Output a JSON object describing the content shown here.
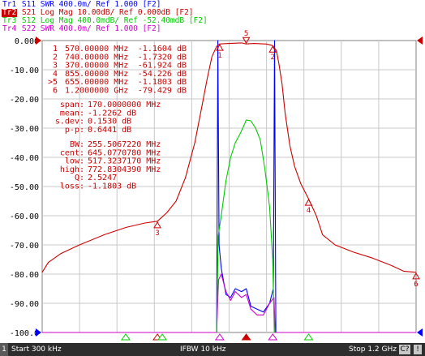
{
  "colors": {
    "tr1": "#0000ff",
    "tr2": "#cc0000",
    "tr3": "#00cc00",
    "tr4": "#cc00cc",
    "grid": "#c8c8c8",
    "bg": "#ffffff"
  },
  "traces": [
    {
      "tag": "Tr1",
      "text": "S11  SWR 400.0m/ Ref 1.000 [F2]",
      "color": "#0000ff",
      "active": false
    },
    {
      "tag": "Tr2",
      "text": "S21  Log Mag 10.00dB/ Ref 0.000dB [F2]",
      "color": "#cc0000",
      "active": true
    },
    {
      "tag": "Tr3",
      "text": "S12  Log Mag 400.0mdB/ Ref -52.40mdB [F2]",
      "color": "#00cc00",
      "active": false
    },
    {
      "tag": "Tr4",
      "text": "S22  SWR 400.0m/ Ref 1.000 [F2]",
      "color": "#cc00cc",
      "active": false
    }
  ],
  "y_axis_labels": [
    "0.000",
    "-10.00",
    "-20.00",
    "-30.00",
    "-40.00",
    "-50.00",
    "-60.00",
    "-70.00",
    "-80.00",
    "-90.00",
    "-100.0"
  ],
  "markers": [
    {
      "id": "1",
      "freq": "570.00000 MHz",
      "value": "-1.1604 dB",
      "active": false
    },
    {
      "id": "2",
      "freq": "740.00000 MHz",
      "value": "-1.7320 dB",
      "active": false
    },
    {
      "id": "3",
      "freq": "370.00000 MHz",
      "value": "-61.924 dB",
      "active": false
    },
    {
      "id": "4",
      "freq": "855.00000 MHz",
      "value": "-54.226 dB",
      "active": false
    },
    {
      "id": "5",
      "freq": "655.00000 MHz",
      "value": "-1.1803 dB",
      "active": true
    },
    {
      "id": "6",
      "freq": "1.2000000 GHz",
      "value": "-79.429 dB",
      "active": false
    }
  ],
  "stats": [
    {
      "label": "span:",
      "value": "170.0000000 MHz"
    },
    {
      "label": "mean:",
      "value": "-1.2262 dB"
    },
    {
      "label": "s.dev:",
      "value": "0.1530 dB"
    },
    {
      "label": "p-p:",
      "value": "0.6441 dB"
    }
  ],
  "filter": [
    {
      "label": "BW:",
      "value": "255.5067220 MHz"
    },
    {
      "label": "cent:",
      "value": "645.0770780 MHz"
    },
    {
      "label": "low:",
      "value": "517.3237170 MHz"
    },
    {
      "label": "high:",
      "value": "772.8304390 MHz"
    },
    {
      "label": "Q:",
      "value": "2.5247"
    },
    {
      "label": "loss:",
      "value": "-1.1803 dB"
    }
  ],
  "status": {
    "channel": "1",
    "start": "Start 300 kHz",
    "ifbw": "IFBW 10 kHz",
    "stop": "Stop 1.2 GHz",
    "c_badge": "C?",
    "check": "!"
  },
  "chart_data": {
    "type": "line",
    "title": "",
    "xlabel": "",
    "ylabel": "",
    "xlim_mhz": [
      0.3,
      1200
    ],
    "ylim": [
      -100,
      0
    ],
    "grid": true,
    "series": [
      {
        "name": "S21 Log Mag",
        "color": "#cc0000",
        "x": [
          0.3,
          20,
          60,
          120,
          200,
          270,
          330,
          370,
          400,
          430,
          460,
          490,
          510,
          530,
          545,
          560,
          570,
          600,
          640,
          655,
          680,
          720,
          740,
          752,
          760,
          770,
          780,
          795,
          810,
          830,
          855,
          880,
          900,
          940,
          1000,
          1060,
          1120,
          1160,
          1200
        ],
        "values": [
          -79.4,
          -76.0,
          -73.0,
          -70.0,
          -66.5,
          -64.0,
          -62.5,
          -61.9,
          -59.0,
          -55.0,
          -47.0,
          -35.0,
          -24.0,
          -13.0,
          -5.5,
          -2.0,
          -1.16,
          -1.0,
          -0.8,
          -1.18,
          -1.0,
          -1.2,
          -1.73,
          -3.5,
          -8.0,
          -15.0,
          -25.0,
          -36.0,
          -43.0,
          -49.0,
          -54.2,
          -60.0,
          -66.5,
          -70.0,
          -72.5,
          -74.5,
          -77.0,
          -79.0,
          -79.4
        ]
      },
      {
        "name": "S12 Log Mag",
        "color": "#00cc00",
        "x": [
          560,
          565,
          575,
          590,
          605,
          620,
          635,
          650,
          655,
          670,
          685,
          700,
          715,
          730,
          740,
          745
        ],
        "values": [
          -100.0,
          -67.0,
          -60.0,
          -48.0,
          -40.0,
          -35.0,
          -32.0,
          -28.5,
          -27.2,
          -27.5,
          -30.0,
          -34.0,
          -44.0,
          -57.0,
          -75.0,
          -100.0
        ]
      },
      {
        "name": "S11 SWR",
        "color": "#0000ff",
        "x": [
          0.3,
          500,
          560,
          564,
          568,
          575,
          590,
          605,
          620,
          640,
          655,
          670,
          690,
          710,
          730,
          742,
          746,
          750,
          1200
        ],
        "values": [
          -100.0,
          -100.0,
          -100.0,
          0.0,
          -70.0,
          -78.0,
          -87.0,
          -88.0,
          -85.0,
          -86.0,
          -85.0,
          -91.0,
          -92.0,
          -93.0,
          -90.0,
          -85.0,
          0.0,
          -100.0,
          -100.0
        ]
      },
      {
        "name": "S22 SWR",
        "color": "#cc00cc",
        "x": [
          0.3,
          500,
          560,
          566,
          575,
          590,
          605,
          620,
          640,
          655,
          670,
          690,
          710,
          730,
          744,
          748,
          1200
        ],
        "values": [
          -100.0,
          -100.0,
          -100.0,
          -82.0,
          -80.0,
          -86.0,
          -89.0,
          -86.0,
          -88.0,
          -87.0,
          -92.0,
          -94.0,
          -94.0,
          -90.0,
          -88.0,
          -100.0,
          -100.0
        ]
      }
    ]
  }
}
